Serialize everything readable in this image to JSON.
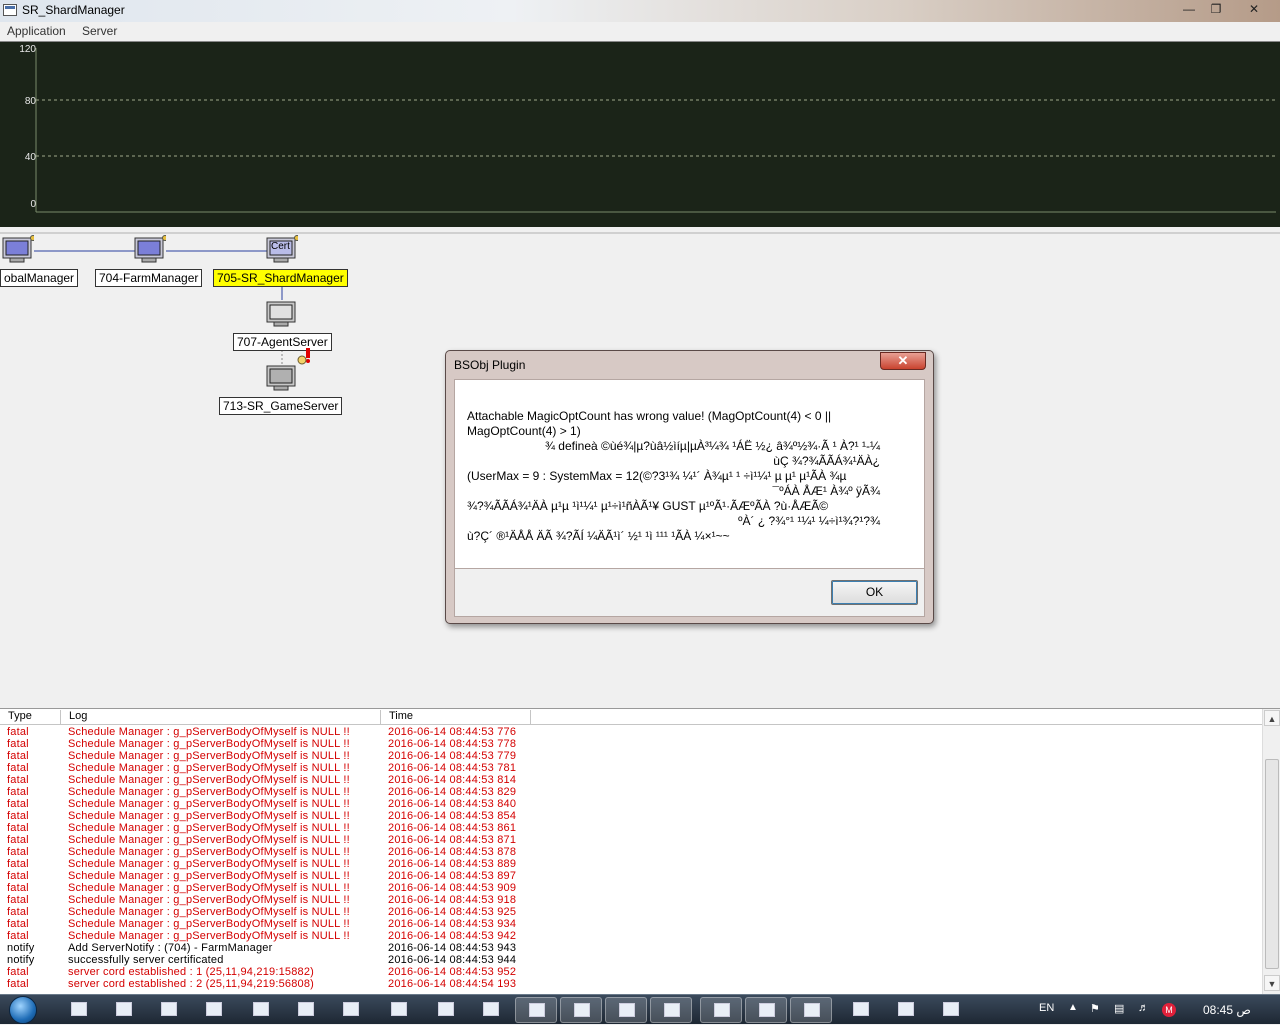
{
  "window": {
    "title": "SR_ShardManager"
  },
  "menu": {
    "items": [
      "Application",
      "Server"
    ]
  },
  "graph": {
    "y_ticks": [
      "120",
      "80",
      "40",
      "0"
    ],
    "background": "#1b2418"
  },
  "topology": {
    "nodes": [
      {
        "label": "obalManager"
      },
      {
        "label": "704-FarmManager"
      },
      {
        "label": "705-SR_ShardManager",
        "icon_text": "Cert"
      },
      {
        "label": "707-AgentServer"
      },
      {
        "label": "713-SR_GameServer"
      }
    ]
  },
  "dialog": {
    "title": "BSObj Plugin",
    "lines": [
      "Attachable MagicOptCount has wrong value! (MagOptCount(4) < 0 ||",
      "MagOptCount(4) > 1)",
      "¼-defineà ©ùé¾|µ?ùâ½ìíµ|µÀ³¼¾ ¹ÁË ½¿ â¾º½¾·Ã ¹ À?¹ ¹ ¾",
      "¿ùÇ ¾?¾ÃÃÁ¾¹ÄÀ",
      "(UserMax = 9 : SystemMax = 12(©?3¹¾ ¼¹´ À¾µ¹ ¹ ÷ì¹¼¹ µ µ¹ µ¹ÃÀ ¾µ",
      "¾ºÁÀ ÅÆ¹ À¾º ÿÃ¯",
      "¾?¾ÃÃÁ¾¹ÄÀ µ¹µ ¹ì¹¼¹ µ¹÷ì¹ñÀÃ¹¥ GUST µ¹ºÃ¹·ÃÆºÃÀ ?ù·ÅÆÃ©",
      "¾?¹?¾ºÀ´ ¿ ?¾°¹ ¹¼¹ ¼÷ì¹",
      "ù?Ç´ ®¹ÄÅÅ ÄÃ ¾?ÃÍ ¼ÄÃ¹ì´ ½¹ ¹ì ¹¹¹ ¹ÃÀ ¼×¹~~"
    ],
    "ok_label": "OK",
    "close_label": "✕"
  },
  "log": {
    "columns": [
      "Type",
      "Log",
      "Time"
    ],
    "rows": [
      {
        "type": "fatal",
        "log": "Schedule Manager : g_pServerBodyOfMyself is NULL !!",
        "time": "2016-06-14 08:44:53 776"
      },
      {
        "type": "fatal",
        "log": "Schedule Manager : g_pServerBodyOfMyself is NULL !!",
        "time": "2016-06-14 08:44:53 778"
      },
      {
        "type": "fatal",
        "log": "Schedule Manager : g_pServerBodyOfMyself is NULL !!",
        "time": "2016-06-14 08:44:53 779"
      },
      {
        "type": "fatal",
        "log": "Schedule Manager : g_pServerBodyOfMyself is NULL !!",
        "time": "2016-06-14 08:44:53 781"
      },
      {
        "type": "fatal",
        "log": "Schedule Manager : g_pServerBodyOfMyself is NULL !!",
        "time": "2016-06-14 08:44:53 814"
      },
      {
        "type": "fatal",
        "log": "Schedule Manager : g_pServerBodyOfMyself is NULL !!",
        "time": "2016-06-14 08:44:53 829"
      },
      {
        "type": "fatal",
        "log": "Schedule Manager : g_pServerBodyOfMyself is NULL !!",
        "time": "2016-06-14 08:44:53 840"
      },
      {
        "type": "fatal",
        "log": "Schedule Manager : g_pServerBodyOfMyself is NULL !!",
        "time": "2016-06-14 08:44:53 854"
      },
      {
        "type": "fatal",
        "log": "Schedule Manager : g_pServerBodyOfMyself is NULL !!",
        "time": "2016-06-14 08:44:53 861"
      },
      {
        "type": "fatal",
        "log": "Schedule Manager : g_pServerBodyOfMyself is NULL !!",
        "time": "2016-06-14 08:44:53 871"
      },
      {
        "type": "fatal",
        "log": "Schedule Manager : g_pServerBodyOfMyself is NULL !!",
        "time": "2016-06-14 08:44:53 878"
      },
      {
        "type": "fatal",
        "log": "Schedule Manager : g_pServerBodyOfMyself is NULL !!",
        "time": "2016-06-14 08:44:53 889"
      },
      {
        "type": "fatal",
        "log": "Schedule Manager : g_pServerBodyOfMyself is NULL !!",
        "time": "2016-06-14 08:44:53 897"
      },
      {
        "type": "fatal",
        "log": "Schedule Manager : g_pServerBodyOfMyself is NULL !!",
        "time": "2016-06-14 08:44:53 909"
      },
      {
        "type": "fatal",
        "log": "Schedule Manager : g_pServerBodyOfMyself is NULL !!",
        "time": "2016-06-14 08:44:53 918"
      },
      {
        "type": "fatal",
        "log": "Schedule Manager : g_pServerBodyOfMyself is NULL !!",
        "time": "2016-06-14 08:44:53 925"
      },
      {
        "type": "fatal",
        "log": "Schedule Manager : g_pServerBodyOfMyself is NULL !!",
        "time": "2016-06-14 08:44:53 934"
      },
      {
        "type": "fatal",
        "log": "Schedule Manager : g_pServerBodyOfMyself is NULL !!",
        "time": "2016-06-14 08:44:53 942"
      },
      {
        "type": "notify",
        "log": "Add ServerNotify : (704) - FarmManager",
        "time": "2016-06-14 08:44:53 943"
      },
      {
        "type": "notify",
        "log": "successfully server certificated",
        "time": "2016-06-14 08:44:53 944"
      },
      {
        "type": "fatal",
        "log": "server cord established : 1 (25,11,94,219:15882)",
        "time": "2016-06-14 08:44:53 952"
      },
      {
        "type": "fatal",
        "log": "server cord established : 2 (25,11,94,219:56808)",
        "time": "2016-06-14 08:44:54 193"
      }
    ]
  },
  "taskbar": {
    "language": "EN",
    "clock": "08:45 ص",
    "apps": [
      "file-manager",
      "firefox",
      "tools",
      "window",
      "window",
      "chrome",
      "photoshop",
      "calculator",
      "window",
      "window",
      "window",
      "window",
      "window",
      "window",
      "window",
      "window",
      "window",
      "folder",
      "cmd",
      "notepad"
    ]
  }
}
